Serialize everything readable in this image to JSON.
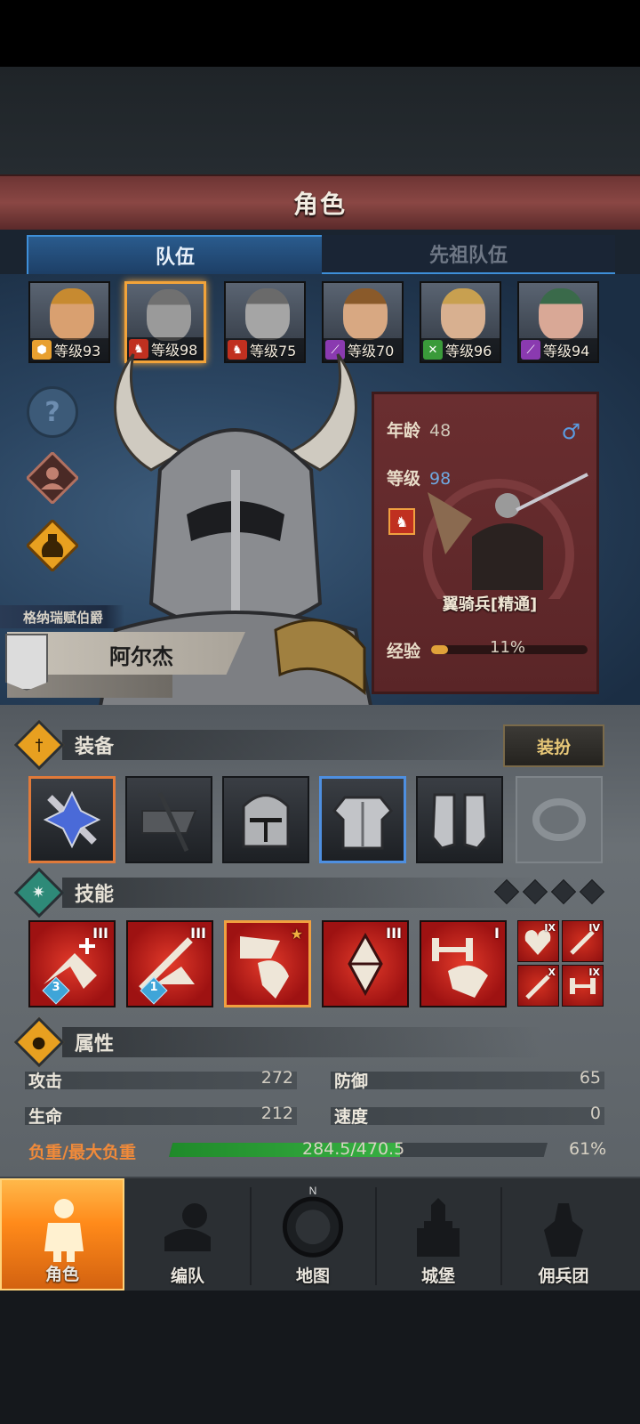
{
  "header": {
    "title": "角色"
  },
  "tabs": [
    {
      "label": "队伍",
      "active": true
    },
    {
      "label": "先祖队伍",
      "active": false
    }
  ],
  "roster": [
    {
      "level_text": "等级93",
      "class_icon": "shield-icon",
      "class_color": "#e8a030",
      "skin": "#d9a070",
      "hair": "#c78a30",
      "selected": false
    },
    {
      "level_text": "等级98",
      "class_icon": "horse-icon",
      "class_color": "#c03020",
      "skin": "#9a9a9a",
      "hair": "#707070",
      "selected": true
    },
    {
      "level_text": "等级75",
      "class_icon": "horse-icon",
      "class_color": "#c03020",
      "skin": "#a5a5a5",
      "hair": "#6a6a6a",
      "selected": false
    },
    {
      "level_text": "等级70",
      "class_icon": "staff-icon",
      "class_color": "#8a3ab0",
      "skin": "#d8a882",
      "hair": "#8a5a2a",
      "selected": false
    },
    {
      "level_text": "等级96",
      "class_icon": "bow-icon",
      "class_color": "#3a9a3a",
      "skin": "#d8b090",
      "hair": "#c8a050",
      "selected": false
    },
    {
      "level_text": "等级94",
      "class_icon": "staff-icon",
      "class_color": "#8a3ab0",
      "skin": "#d9a896",
      "hair": "#3a6a4a",
      "selected": false
    }
  ],
  "side_buttons": [
    "help-icon",
    "squad-icon",
    "potion-icon"
  ],
  "help_glyph": "?",
  "character": {
    "title": "格纳瑞赋伯爵",
    "name": "阿尔杰",
    "age_label": "年龄",
    "age": "48",
    "level_label": "等级",
    "level": "98",
    "unit_class": "翼骑兵[精通]",
    "xp_label": "经验",
    "xp_percent": "11%",
    "xp_fraction": 0.11,
    "gender_glyph": "♂"
  },
  "equipment": {
    "title": "装备",
    "dress_button": "装扮",
    "slots": [
      "weapon-icon",
      "banner-icon",
      "helmet-icon",
      "armor-icon",
      "greaves-icon",
      "ring-icon"
    ]
  },
  "skills": {
    "title": "技能",
    "main": [
      {
        "roman": "III",
        "badge": "3"
      },
      {
        "roman": "III",
        "badge": "1"
      },
      {
        "roman": "★",
        "badge": ""
      },
      {
        "roman": "III",
        "badge": ""
      },
      {
        "roman": "I",
        "badge": ""
      }
    ],
    "mini": [
      "IX",
      "IV",
      "X",
      "IX"
    ]
  },
  "attributes": {
    "title": "属性",
    "attack_label": "攻击",
    "attack": "272",
    "defense_label": "防御",
    "defense": "65",
    "hp_label": "生命",
    "hp": "212",
    "speed_label": "速度",
    "speed": "0",
    "load_label": "负重/最大负重",
    "load_value": "284.5/470.5",
    "load_percent": "61%",
    "load_fraction": 0.61
  },
  "nav": [
    {
      "label": "角色",
      "active": true
    },
    {
      "label": "编队",
      "active": false
    },
    {
      "label": "地图",
      "active": false
    },
    {
      "label": "城堡",
      "active": false
    },
    {
      "label": "佣兵团",
      "active": false
    }
  ],
  "compass_letter": "N",
  "colors": {
    "accent": "#f2a33a",
    "tab_blue": "#3e8fd9",
    "panel_red": "#6a2e30",
    "skill_red": "#c81e1e"
  }
}
